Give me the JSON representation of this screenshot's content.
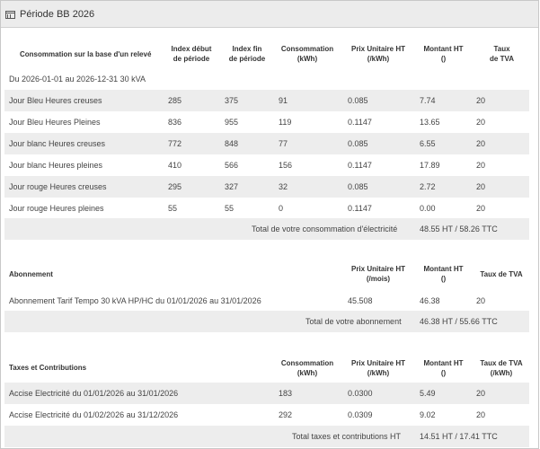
{
  "panel": {
    "title": "Période BB 2026",
    "icon": "list-icon"
  },
  "consumption": {
    "headers": {
      "label": "Consommation sur la base d'un relevé",
      "index_start": [
        "Index début",
        "de période"
      ],
      "index_end": [
        "Index fin",
        "de période"
      ],
      "consumption": [
        "Consommation",
        "(kWh)"
      ],
      "unit_price": [
        "Prix Unitaire HT",
        "(/kWh)"
      ],
      "amount": [
        "Montant HT",
        "()"
      ],
      "vat": [
        "Taux",
        "de TVA"
      ]
    },
    "period": "Du 2026-01-01 au 2026-12-31 30 kVA",
    "rows": [
      {
        "label": "Jour Bleu Heures creuses",
        "start": "285",
        "end": "375",
        "kwh": "91",
        "price": "0.085",
        "amount": "7.74",
        "vat": "20"
      },
      {
        "label": "Jour Bleu Heures Pleines",
        "start": "836",
        "end": "955",
        "kwh": "119",
        "price": "0.1147",
        "amount": "13.65",
        "vat": "20"
      },
      {
        "label": "Jour blanc Heures creuses",
        "start": "772",
        "end": "848",
        "kwh": "77",
        "price": "0.085",
        "amount": "6.55",
        "vat": "20"
      },
      {
        "label": "Jour blanc Heures pleines",
        "start": "410",
        "end": "566",
        "kwh": "156",
        "price": "0.1147",
        "amount": "17.89",
        "vat": "20"
      },
      {
        "label": "Jour rouge Heures creuses",
        "start": "295",
        "end": "327",
        "kwh": "32",
        "price": "0.085",
        "amount": "2.72",
        "vat": "20"
      },
      {
        "label": "Jour rouge Heures pleines",
        "start": "55",
        "end": "55",
        "kwh": "0",
        "price": "0.1147",
        "amount": "0.00",
        "vat": "20"
      }
    ],
    "total_label": "Total de votre consommation d'électricité",
    "total_value": "48.55 HT / 58.26 TTC"
  },
  "subscription": {
    "headers": {
      "label": "Abonnement",
      "unit_price": [
        "Prix Unitaire HT",
        "(/mois)"
      ],
      "amount": [
        "Montant HT",
        "()"
      ],
      "vat": "Taux de TVA"
    },
    "row": {
      "label": "Abonnement Tarif Tempo 30 kVA HP/HC du 01/01/2026 au 31/01/2026",
      "price": "45.508",
      "amount": "46.38",
      "vat": "20"
    },
    "total_label": "Total de votre abonnement",
    "total_value": "46.38 HT / 55.66 TTC"
  },
  "taxes": {
    "headers": {
      "label": "Taxes et Contributions",
      "consumption": [
        "Consommation",
        "(kWh)"
      ],
      "unit_price": [
        "Prix Unitaire HT",
        "(/kWh)"
      ],
      "amount": [
        "Montant HT",
        "()"
      ],
      "vat": [
        "Taux de TVA",
        "(/kWh)"
      ]
    },
    "rows": [
      {
        "label": "Accise Electricité du 01/01/2026 au 31/01/2026",
        "kwh": "183",
        "price": "0.0300",
        "amount": "5.49",
        "vat": "20"
      },
      {
        "label": "Accise Electricité du 01/02/2026 au 31/12/2026",
        "kwh": "292",
        "price": "0.0309",
        "amount": "9.02",
        "vat": "20"
      }
    ],
    "total_label": "Total taxes et contributions HT",
    "total_value": "14.51 HT / 17.41 TTC"
  }
}
